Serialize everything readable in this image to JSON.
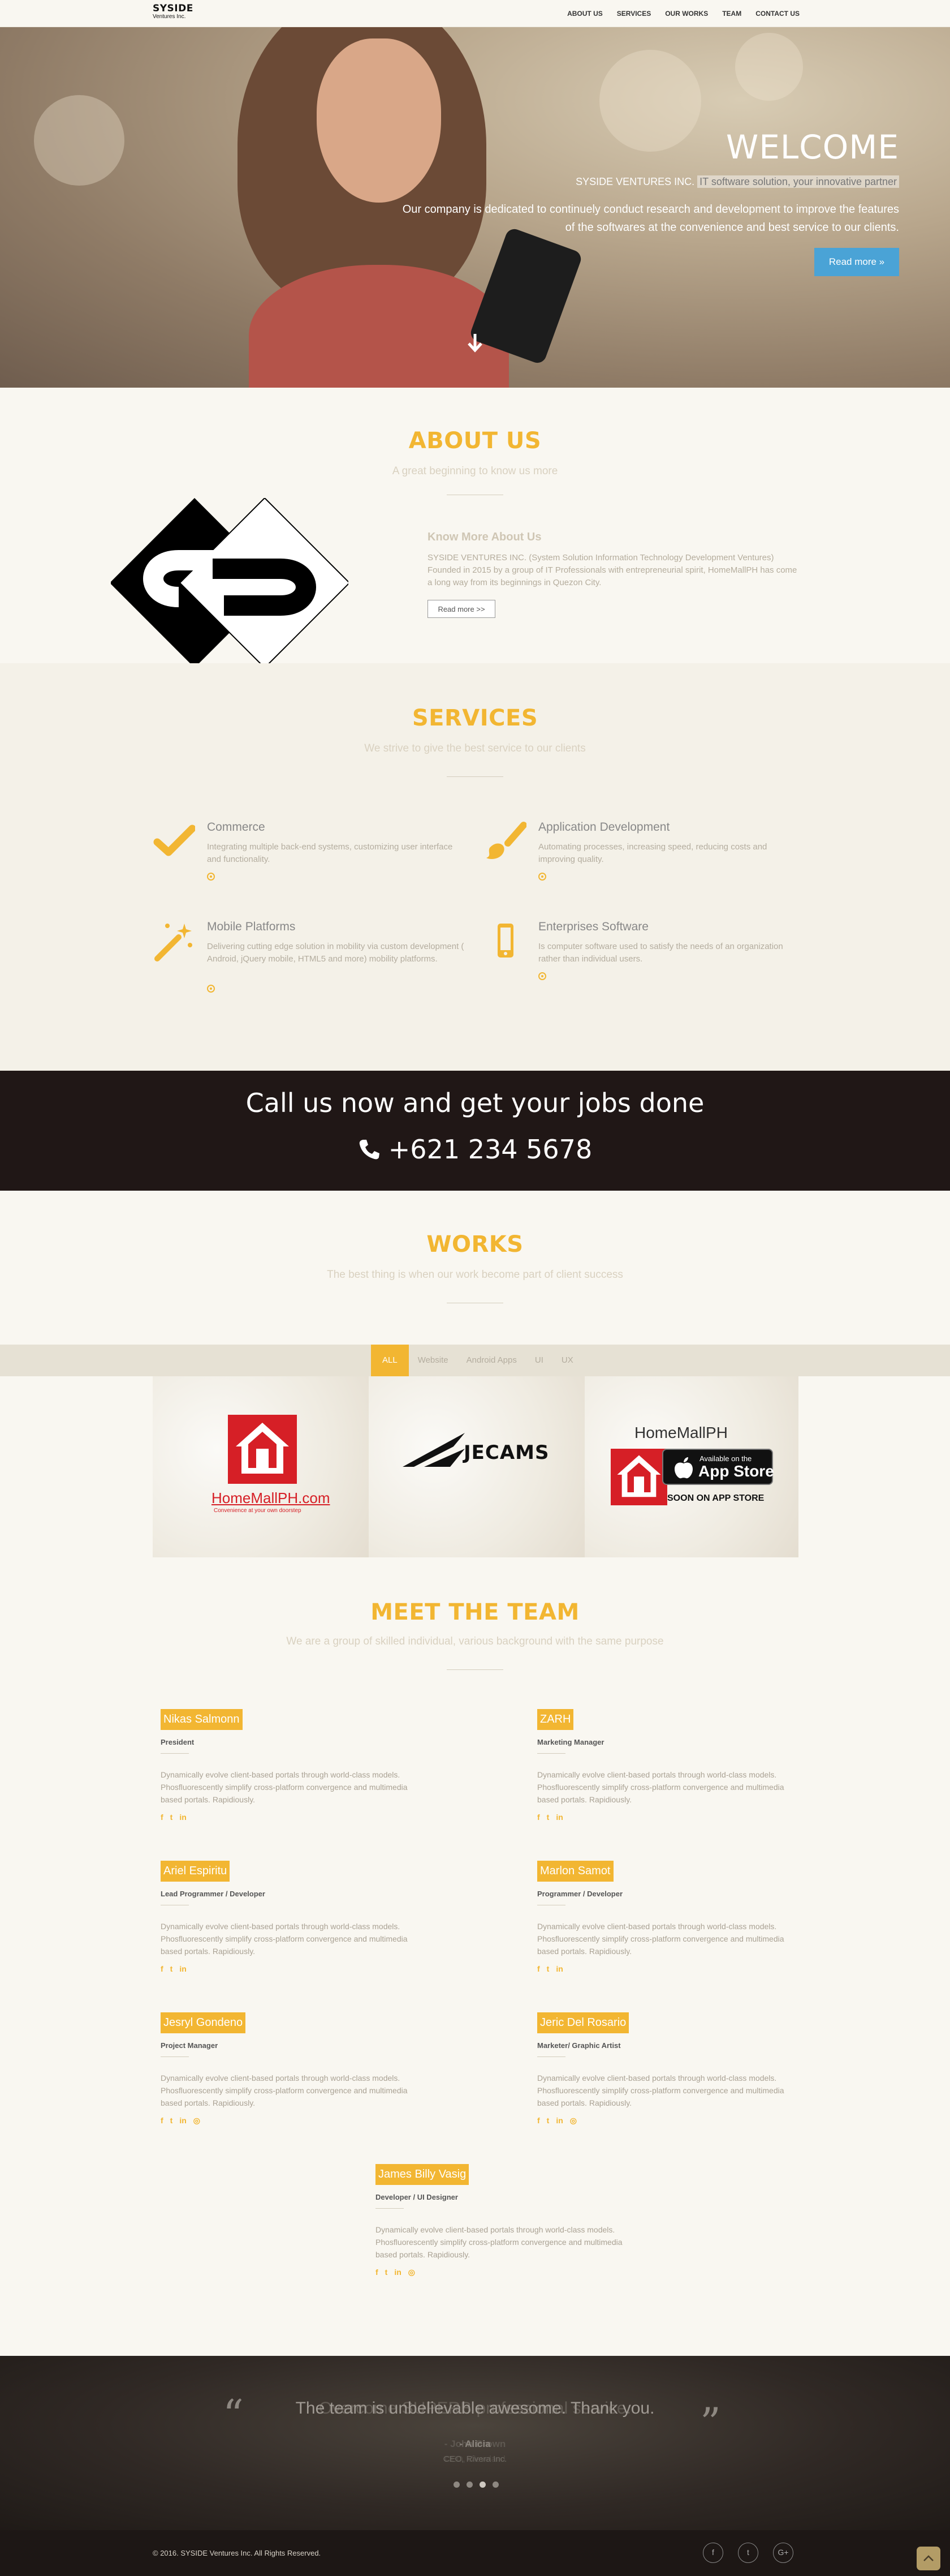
{
  "colors": {
    "accent": "#f2b632",
    "hero_button": "#4aa3d6",
    "dark_band": "#201716"
  },
  "nav": {
    "logo_main": "SYSIDE",
    "logo_sub": "Ventures Inc.",
    "links": [
      "ABOUT US",
      "SERVICES",
      "OUR WORKS",
      "TEAM",
      "CONTACT US"
    ]
  },
  "hero": {
    "title": "WELCOME",
    "tag_prefix": "SYSIDE VENTURES INC.",
    "tag_highlight": "IT software solution, your innovative partner",
    "description": "Our company is dedicated to continuely conduct research and development to improve the features of the softwares at the convenience and best service to our clients.",
    "button": "Read more »",
    "scroll_icon": "arrow-down-icon"
  },
  "about": {
    "title": "ABOUT US",
    "subtitle": "A great beginning to know us more",
    "heading": "Know More About Us",
    "text": "SYSIDE VENTURES INC. (System Solution Information Technology Development Ventures) Founded in 2015 by a group of IT Professionals with entrepreneurial spirit, HomeMallPH has come a long way from its beginnings in Quezon City.",
    "button": "Read more >>"
  },
  "services": {
    "title": "SERVICES",
    "subtitle": "We strive to give the best service to our clients",
    "items": [
      {
        "icon": "checkmark-icon",
        "title": "Commerce",
        "desc": "Integrating multiple back-end systems, customizing user interface and functionality."
      },
      {
        "icon": "paintbrush-icon",
        "title": "Application Development",
        "desc": "Automating processes, increasing speed, reducing costs and improving quality."
      },
      {
        "icon": "magic-wand-icon",
        "title": "Mobile Platforms",
        "desc": "Delivering cutting edge solution in mobility via custom development ( Android, jQuery mobile, HTML5 and more) mobility platforms."
      },
      {
        "icon": "mobile-phone-icon",
        "title": "Enterprises Software",
        "desc": "Is computer software used to satisfy the needs of an organization rather than individual users."
      }
    ]
  },
  "call": {
    "title": "Call us now and get your jobs done",
    "phone": "+621 234 5678"
  },
  "works": {
    "title": "WORKS",
    "subtitle": "The best thing is when our work become part of client success",
    "filters": [
      "ALL",
      "Website",
      "Android Apps",
      "UI",
      "UX"
    ],
    "items": [
      {
        "label": "HomeMallPH.com",
        "tagline": "Convenience at your own doorstep"
      },
      {
        "label": "JECAMS"
      },
      {
        "label": "HomeMallPH",
        "badge_small": "Available on the",
        "badge_big": "App Store",
        "note": "SOON ON APP STORE"
      }
    ]
  },
  "team": {
    "title": "MEET THE TEAM",
    "subtitle": "We are a group of skilled individual, various background with the same purpose",
    "bio": "Dynamically evolve client-based portals through world-class models. Phosfluorescently simplify cross-platform convergence and multimedia based portals. Rapidiously.",
    "members": [
      {
        "name": "Nikas Salmonn",
        "role": "President",
        "social": [
          "f",
          "t",
          "in"
        ]
      },
      {
        "name": "ZARH",
        "role": "Marketing Manager",
        "social": [
          "f",
          "t",
          "in"
        ]
      },
      {
        "name": "Ariel Espiritu",
        "role": "Lead Programmer / Developer",
        "social": [
          "f",
          "t",
          "in"
        ]
      },
      {
        "name": "Marlon Samot",
        "role": "Programmer / Developer",
        "social": [
          "f",
          "t",
          "in"
        ]
      },
      {
        "name": "Jesryl Gondeno",
        "role": "Project Manager",
        "social": [
          "f",
          "t",
          "in",
          "◎"
        ]
      },
      {
        "name": "Jeric Del Rosario",
        "role": "Marketer/ Graphic Artist",
        "social": [
          "f",
          "t",
          "in",
          "◎"
        ]
      },
      {
        "name": "James Billy Vasig",
        "role": "Developer / UI Designer",
        "social": [
          "f",
          "t",
          "in",
          "◎"
        ]
      }
    ]
  },
  "testimonial": {
    "quote": "The team is unbelievable awesome. Thank you.",
    "author": "- Alicia",
    "position": "CEO, Rivera Inc.",
    "quote_ghost": "Overcome SUPERB professional service.",
    "author_ghost": "- John Brown",
    "position_ghost": "CEO, Cleveland",
    "slide_count": 4,
    "active_slide": 3
  },
  "footer": {
    "copyright": "© 2016. SYSIDE Ventures Inc. All Rights Reserved.",
    "social": [
      "f",
      "t",
      "G+"
    ]
  }
}
